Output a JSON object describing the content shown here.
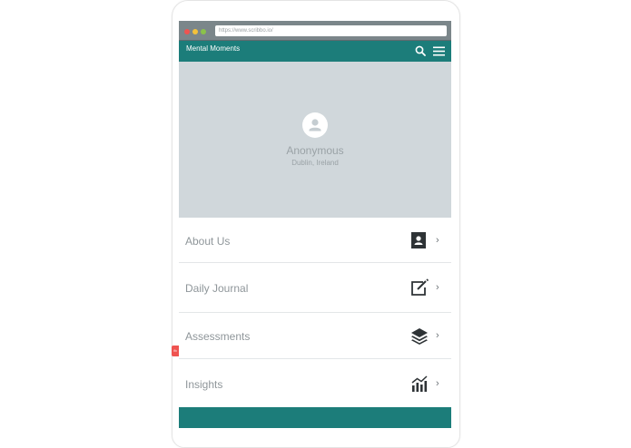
{
  "browser": {
    "url": "https://www.scribbo.io/"
  },
  "app": {
    "title": "Mental Moments",
    "accent_color": "#1c7d7a",
    "search_icon": "search-icon",
    "menu_icon": "hamburger-menu-icon"
  },
  "profile": {
    "name": "Anonymous",
    "location": "Dublin, Ireland",
    "avatar_icon": "user-avatar-icon"
  },
  "menu": {
    "items": [
      {
        "label": "About Us",
        "icon": "contact-card-icon"
      },
      {
        "label": "Daily Journal",
        "icon": "edit-note-icon"
      },
      {
        "label": "Assessments",
        "icon": "layers-icon"
      },
      {
        "label": "Insights",
        "icon": "chart-icon"
      }
    ],
    "chevron": "›"
  },
  "side_tab": {
    "label": "fb"
  }
}
